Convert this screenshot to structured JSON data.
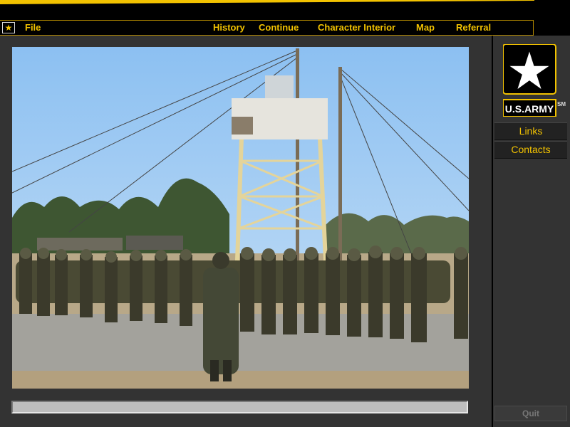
{
  "menu": {
    "file": "File",
    "items": [
      "History",
      "Continue",
      "Character Interior",
      "Map",
      "Referral"
    ]
  },
  "brand": {
    "logo_text": "U.S.ARMY",
    "service_mark": "SM"
  },
  "side": {
    "links": "Links",
    "contacts": "Contacts",
    "quit": "Quit"
  },
  "progress": {
    "value": 0
  },
  "colors": {
    "accent": "#f2c200",
    "panel": "#333333"
  },
  "photo_icon": "training-tower-photo"
}
